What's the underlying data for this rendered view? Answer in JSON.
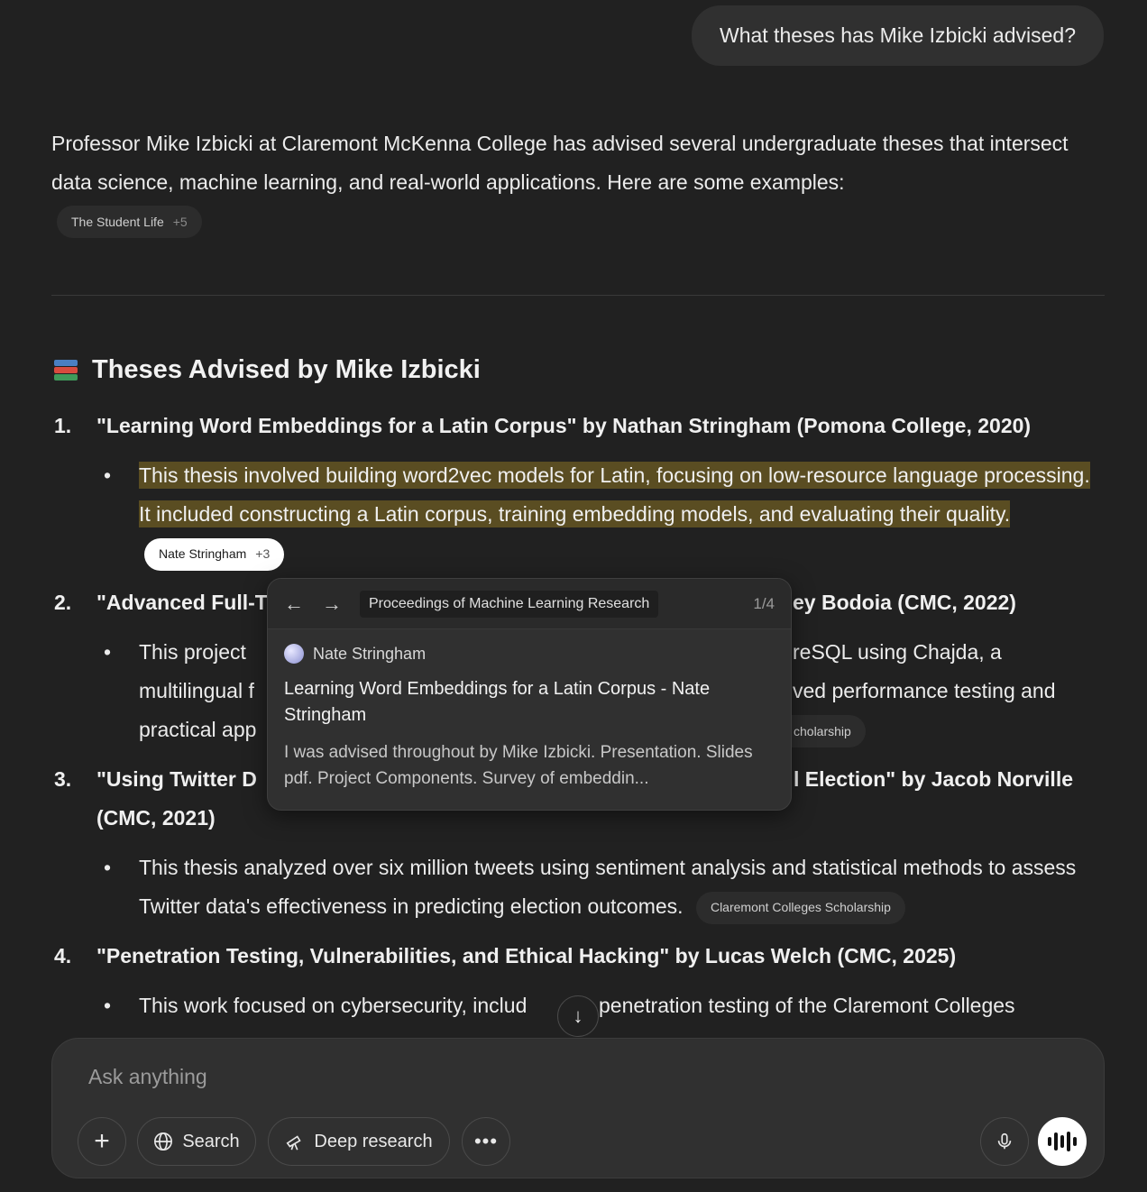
{
  "user_message": "What theses has Mike Izbicki advised?",
  "intro": "Professor Mike Izbicki at Claremont McKenna College has advised several undergraduate theses that intersect data science, machine learning, and real-world applications. Here are some examples:",
  "intro_source": {
    "label": "The Student Life",
    "more": "+5"
  },
  "heading": "Theses Advised by Mike Izbicki",
  "items": [
    {
      "num": "1.",
      "title": "\"Learning Word Embeddings for a Latin Corpus\" by Nathan Stringham (Pomona College, 2020)",
      "bullet_hl1": "This thesis involved building word2vec models for Latin, focusing on low-resource language processing.",
      "bullet_hl2": "It included constructing a Latin corpus, training embedding models, and evaluating their quality.",
      "source": {
        "label": "Nate Stringham",
        "more": "+3"
      }
    },
    {
      "num": "2.",
      "title_left": "\"Advanced Full-T",
      "title_right": "ey Bodoia (CMC, 2022)",
      "bullet_l1_left": "This project ",
      "bullet_l1_right": "reSQL using Chajda, a",
      "bullet_l2_left": "multilingual f",
      "bullet_l2_right": "ved performance testing and",
      "bullet_l3_left": "practical app",
      "source_partial": "cholarship"
    },
    {
      "num": "3.",
      "title_left": "\"Using Twitter D",
      "title_right": "l Election\" by Jacob Norville",
      "title_l2": "(CMC, 2021)",
      "bullet": "This thesis analyzed over six million tweets using sentiment analysis and statistical methods to assess Twitter data's effectiveness in predicting election outcomes.",
      "source": {
        "label": "Claremont Colleges Scholarship"
      }
    },
    {
      "num": "4.",
      "title": "\"Penetration Testing, Vulnerabilities, and Ethical Hacking\" by Lucas Welch (CMC, 2025)",
      "bullet_left": "This work focused on cybersecurity, includ",
      "bullet_right": "penetration testing of the Claremont Colleges"
    }
  ],
  "popover": {
    "source_name": "Proceedings of Machine Learning Research",
    "count": "1/4",
    "author": "Nate Stringham",
    "title": "Learning Word Embeddings for a Latin Corpus - Nate Stringham",
    "snippet": "I was advised throughout by Mike Izbicki. Presentation. Slides pdf. Project Components. Survey of embeddin..."
  },
  "composer": {
    "placeholder": "Ask anything",
    "search_label": "Search",
    "deep_research_label": "Deep research"
  }
}
